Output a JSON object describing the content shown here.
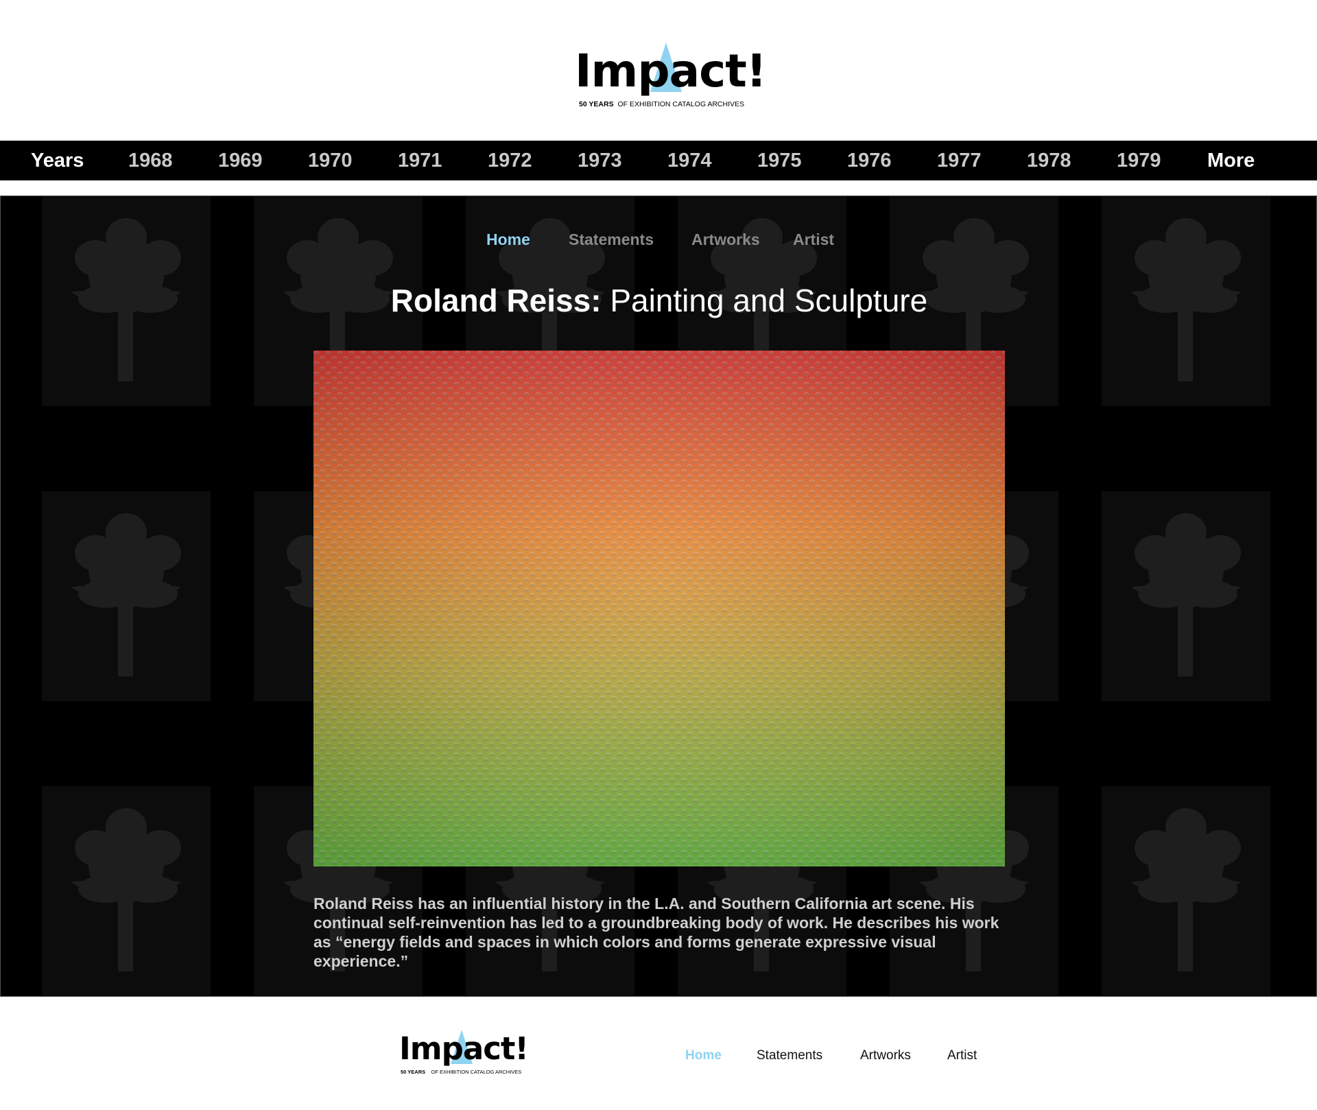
{
  "brand": {
    "name": "Impact!",
    "tagline_bold": "50 YEARS",
    "tagline_rest": "OF EXHIBITION CATALOG ARCHIVES",
    "accent_color": "#8fd3f0"
  },
  "years_nav": {
    "label": "Years",
    "years": [
      "1968",
      "1969",
      "1970",
      "1971",
      "1972",
      "1973",
      "1974",
      "1975",
      "1976",
      "1977",
      "1978",
      "1979"
    ],
    "more": "More"
  },
  "sub_nav": {
    "items": [
      "Home",
      "Statements",
      "Artworks",
      "Artist"
    ],
    "active": "Home"
  },
  "page": {
    "title_bold": "Roland Reiss:",
    "title_rest": "Painting and Sculpture",
    "artwork": {
      "icon": "artwork-image",
      "colors": {
        "top": "#e03a35",
        "middle": "#e8832f",
        "bottom": "#6abf45"
      }
    },
    "description": "Roland Reiss has an influential history in the L.A. and Southern California art scene. His continual self-reinvention has led to a groundbreaking body of work. He describes his work as “energy fields and spaces in which colors and forms generate expressive visual experience.”"
  },
  "footer_nav": {
    "items": [
      "Home",
      "Statements",
      "Artworks",
      "Artist"
    ],
    "active": "Home"
  }
}
